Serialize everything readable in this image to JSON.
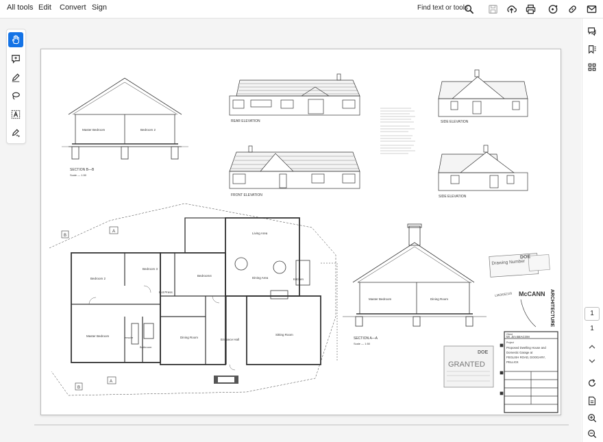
{
  "menu": {
    "all_tools": "All tools",
    "edit": "Edit",
    "convert": "Convert",
    "sign": "Sign"
  },
  "toolbar": {
    "find_label": "Find text or tools",
    "icons": [
      "search-icon",
      "save-icon",
      "upload-icon",
      "print-icon",
      "ai-assistant-icon",
      "link-icon",
      "mail-icon"
    ]
  },
  "left_tools": [
    "hand-icon",
    "comment-icon",
    "pen-icon",
    "lasso-icon",
    "text-select-icon",
    "signature-icon"
  ],
  "right_rail": {
    "icons": [
      "comments-icon",
      "bookmarks-icon",
      "thumbnails-icon"
    ],
    "page_current": "1",
    "page_total": "1",
    "bottom_icons": [
      "chevron-up-icon",
      "chevron-down-icon",
      "refresh-icon",
      "extract-page-icon",
      "zoom-in-icon",
      "zoom-out-icon"
    ]
  },
  "drawing": {
    "section_bb": "SECTION  B—B",
    "section_bb_scale": "Scale  —  1:50",
    "section_bb_rooms": [
      "Master Bedroom",
      "Bedroom 2"
    ],
    "rear_elevation": "REAR ELEVATION",
    "front_elevation": "FRONT ELEVATION",
    "side_elevation_1": "SIDE ELEVATION",
    "side_elevation_2": "SIDE ELEVATION",
    "section_aa": "SECTION  A—A",
    "section_aa_scale": "Scale  —  1:50",
    "section_aa_rooms": [
      "Master Bedroom",
      "Dining Room"
    ],
    "plan_rooms": {
      "living_area": "Living Area",
      "bedroom3": "Bedroom 3",
      "bedroom4": "Bedroom4",
      "bedroom2": "Bedroom 2",
      "dining_area": "Dining Area",
      "kitchen": "Kitchen",
      "hot_press": "Hot Press",
      "master_bedroom": "Master Bedroom",
      "ensuite": "ensuite",
      "bathroom": "Bathroom",
      "dining_room": "Dining Room",
      "entrance_hall": "Entrance Hall",
      "sitting_room": "Sitting Room"
    },
    "section_markers": [
      "A",
      "B",
      "A",
      "B"
    ],
    "stamps": {
      "drawing_number": "Drawing Number",
      "doe_1": "DOE",
      "granted": "GRANTED",
      "doe_2": "DOE",
      "ref": "LMO/0521/8",
      "mccann": "McCANN",
      "architecture": "ARCHITECTURE"
    },
    "title_block": {
      "client_label": "Client",
      "client": "Mr. Jim BEACOM",
      "project_label": "Project",
      "project_lines": [
        "Proposed Dwelling House and",
        "Domestic Garage at",
        "FEGLISH ROAD, DOOGARY,",
        "PELLICK"
      ]
    }
  }
}
